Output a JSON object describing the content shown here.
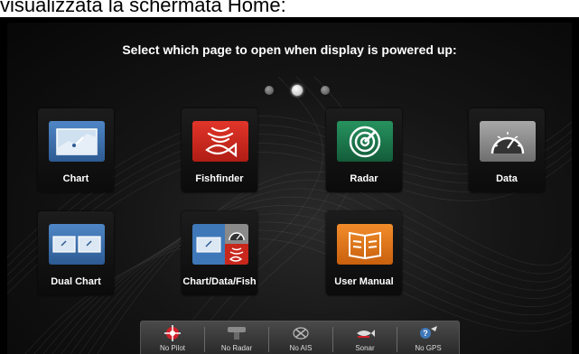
{
  "caption": "visualizzata la schermata Home:",
  "title": "Select which page to open when display is powered up:",
  "pager": {
    "pages": 3,
    "active_index": 1
  },
  "tiles": [
    {
      "label": "Chart",
      "icon": "chart-icon"
    },
    {
      "label": "Fishfinder",
      "icon": "fishfinder-icon"
    },
    {
      "label": "Radar",
      "icon": "radar-icon"
    },
    {
      "label": "Data",
      "icon": "data-gauge-icon"
    },
    {
      "label": "Dual Chart",
      "icon": "dual-chart-icon"
    },
    {
      "label": "Chart/Data/Fish",
      "icon": "chart-data-fish-icon"
    },
    {
      "label": "User Manual",
      "icon": "user-manual-icon"
    }
  ],
  "status_bar": [
    {
      "label": "No Pilot",
      "icon": "pilot-icon"
    },
    {
      "label": "No Radar",
      "icon": "radar-scanner-icon"
    },
    {
      "label": "No AIS",
      "icon": "ais-icon"
    },
    {
      "label": "Sonar",
      "icon": "sonar-icon"
    },
    {
      "label": "No GPS",
      "icon": "gps-icon"
    }
  ],
  "colors": {
    "chart": "#3a6ea8",
    "fishfinder": "#c8271c",
    "radar": "#1d7a4e",
    "data": "#8a8a8a",
    "user_manual": "#e0781a",
    "pilot": "#d0202a"
  }
}
